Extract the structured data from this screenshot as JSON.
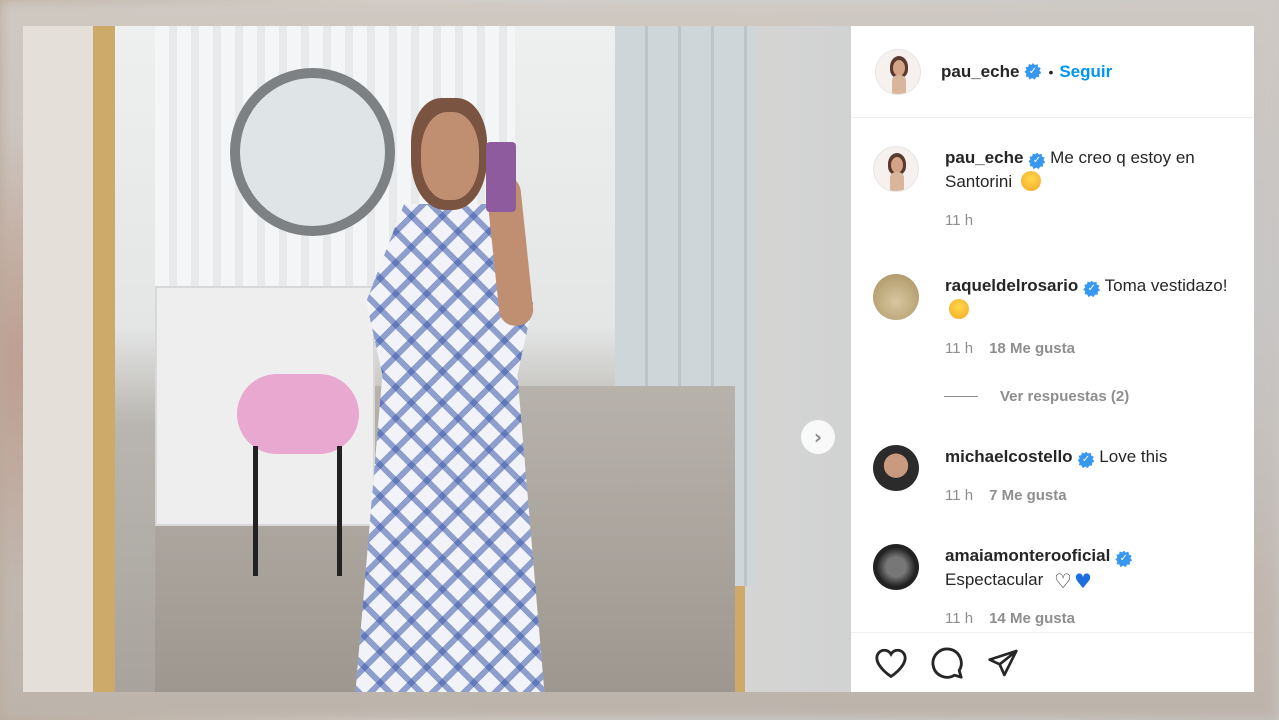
{
  "post": {
    "author": "pau_eche",
    "follow_label": "Seguir",
    "separator": "•"
  },
  "comments": [
    {
      "username": "pau_eche",
      "text": "Me creo q estoy en Santorini",
      "emoji": "grinning-sweat-emoji",
      "time": "11 h",
      "likes": ""
    },
    {
      "username": "raqueldelrosario",
      "text": "Toma vestidazo!",
      "emoji": "star-struck-emoji",
      "time": "11 h",
      "likes": "18 Me gusta"
    },
    {
      "username": "michaelcostello",
      "text": "Love this",
      "time": "11 h",
      "likes": "7 Me gusta"
    },
    {
      "username": "amaiamonterooficial",
      "text": "Espectacular",
      "time": "11 h",
      "likes": "14 Me gusta"
    }
  ],
  "replies_label": "Ver respuestas (2)",
  "next_arrow": "›",
  "icons": {
    "like": "heart-icon",
    "comment": "comment-icon",
    "share": "share-icon",
    "verified": "verified-badge-icon"
  },
  "colors": {
    "accent": "#0095f6",
    "verified": "#3897f0",
    "frame_gold": "#cda96a"
  }
}
